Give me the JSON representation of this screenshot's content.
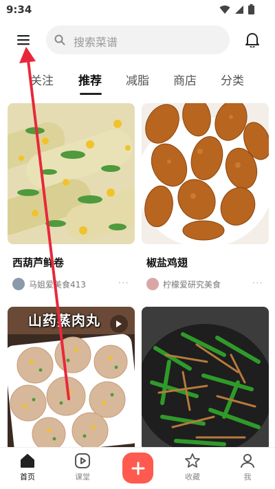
{
  "status_bar": {
    "time": "9:34"
  },
  "search": {
    "placeholder": "搜索菜谱"
  },
  "tabs": [
    {
      "label": "关注"
    },
    {
      "label": "推荐"
    },
    {
      "label": "减脂"
    },
    {
      "label": "商店"
    },
    {
      "label": "分类"
    }
  ],
  "active_tab": "推荐",
  "feed": [
    {
      "title": "西葫芦鲜卷",
      "author": "马姐爱美食413"
    },
    {
      "title": "椒盐鸡翅",
      "author": "柠檬爱研究美食"
    },
    {
      "overlay_title": "山药蒸肉丸"
    },
    {}
  ],
  "bottom_nav": {
    "home": "首页",
    "class": "课堂",
    "collect": "收藏",
    "me": "我"
  },
  "colors": {
    "accent": "#ff5a4f",
    "annotation": "#e8283a"
  }
}
